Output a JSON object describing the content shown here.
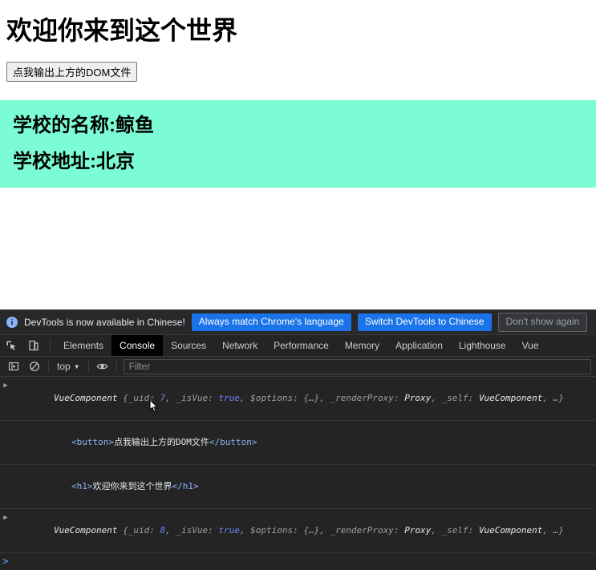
{
  "page": {
    "heading": "欢迎你来到这个世界",
    "button_label": "点我输出上方的DOM文件",
    "school_block_bg": "#7bfcd4",
    "school_lines": [
      "学校的名称:鲸鱼",
      "学校地址:北京"
    ]
  },
  "devtools": {
    "infobar": {
      "icon": "info-icon",
      "glyph": "i",
      "message": "DevTools is now available in Chinese!",
      "buttons": [
        {
          "label": "Always match Chrome's language",
          "style": "primary"
        },
        {
          "label": "Switch DevTools to Chinese",
          "style": "primary"
        },
        {
          "label": "Don't show again",
          "style": "secondary"
        }
      ],
      "primary_color": "#1a73e8"
    },
    "toolbar_icons": [
      {
        "name": "inspect-element-icon"
      },
      {
        "name": "device-toolbar-icon"
      }
    ],
    "tabs": [
      {
        "label": "Elements",
        "active": false
      },
      {
        "label": "Console",
        "active": true
      },
      {
        "label": "Sources",
        "active": false
      },
      {
        "label": "Network",
        "active": false
      },
      {
        "label": "Performance",
        "active": false
      },
      {
        "label": "Memory",
        "active": false
      },
      {
        "label": "Application",
        "active": false
      },
      {
        "label": "Lighthouse",
        "active": false
      },
      {
        "label": "Vue",
        "active": false
      }
    ],
    "console_toolbar": {
      "sidebar_toggle": "console-sidebar-icon",
      "clear_icon": "clear-console-icon",
      "context": "top",
      "context_caret": "▼",
      "eye_icon": "live-expression-icon",
      "filter_placeholder": "Filter",
      "filter_value": ""
    },
    "messages": [
      {
        "type": "object",
        "expandable": true,
        "arrow": "▶",
        "tokens": [
          {
            "t": "obj",
            "v": "VueComponent"
          },
          {
            "t": "punct",
            "v": " {"
          },
          {
            "t": "key",
            "v": "_uid"
          },
          {
            "t": "punct",
            "v": ": "
          },
          {
            "t": "num",
            "v": "7"
          },
          {
            "t": "punct",
            "v": ", "
          },
          {
            "t": "key",
            "v": "_isVue"
          },
          {
            "t": "punct",
            "v": ": "
          },
          {
            "t": "bool",
            "v": "true"
          },
          {
            "t": "punct",
            "v": ", "
          },
          {
            "t": "key",
            "v": "$options"
          },
          {
            "t": "punct",
            "v": ": "
          },
          {
            "t": "ell",
            "v": "{…}"
          },
          {
            "t": "punct",
            "v": ", "
          },
          {
            "t": "key",
            "v": "_renderProxy"
          },
          {
            "t": "punct",
            "v": ": "
          },
          {
            "t": "obj",
            "v": "Proxy"
          },
          {
            "t": "punct",
            "v": ", "
          },
          {
            "t": "key",
            "v": "_self"
          },
          {
            "t": "punct",
            "v": ": "
          },
          {
            "t": "obj",
            "v": "VueComponent"
          },
          {
            "t": "punct",
            "v": ", "
          },
          {
            "t": "ell",
            "v": "…}"
          }
        ]
      },
      {
        "type": "dom",
        "expandable": false,
        "indent": true,
        "tokens": [
          {
            "t": "tag",
            "v": "<button>"
          },
          {
            "t": "text",
            "v": "点我输出上方的DOM文件"
          },
          {
            "t": "tag",
            "v": "</button>"
          }
        ]
      },
      {
        "type": "dom",
        "expandable": false,
        "indent": true,
        "tokens": [
          {
            "t": "tag",
            "v": "<h1>"
          },
          {
            "t": "text",
            "v": "欢迎你来到这个世界"
          },
          {
            "t": "tag",
            "v": "</h1>"
          }
        ]
      },
      {
        "type": "object",
        "expandable": true,
        "arrow": "▶",
        "tokens": [
          {
            "t": "obj",
            "v": "VueComponent"
          },
          {
            "t": "punct",
            "v": " {"
          },
          {
            "t": "key",
            "v": "_uid"
          },
          {
            "t": "punct",
            "v": ": "
          },
          {
            "t": "num",
            "v": "8"
          },
          {
            "t": "punct",
            "v": ", "
          },
          {
            "t": "key",
            "v": "_isVue"
          },
          {
            "t": "punct",
            "v": ": "
          },
          {
            "t": "bool",
            "v": "true"
          },
          {
            "t": "punct",
            "v": ", "
          },
          {
            "t": "key",
            "v": "$options"
          },
          {
            "t": "punct",
            "v": ": "
          },
          {
            "t": "ell",
            "v": "{…}"
          },
          {
            "t": "punct",
            "v": ", "
          },
          {
            "t": "key",
            "v": "_renderProxy"
          },
          {
            "t": "punct",
            "v": ": "
          },
          {
            "t": "obj",
            "v": "Proxy"
          },
          {
            "t": "punct",
            "v": ", "
          },
          {
            "t": "key",
            "v": "_self"
          },
          {
            "t": "punct",
            "v": ": "
          },
          {
            "t": "obj",
            "v": "VueComponent"
          },
          {
            "t": "punct",
            "v": ", "
          },
          {
            "t": "ell",
            "v": "…}"
          }
        ]
      }
    ],
    "prompt": {
      "chevron": ">",
      "value": ""
    }
  }
}
